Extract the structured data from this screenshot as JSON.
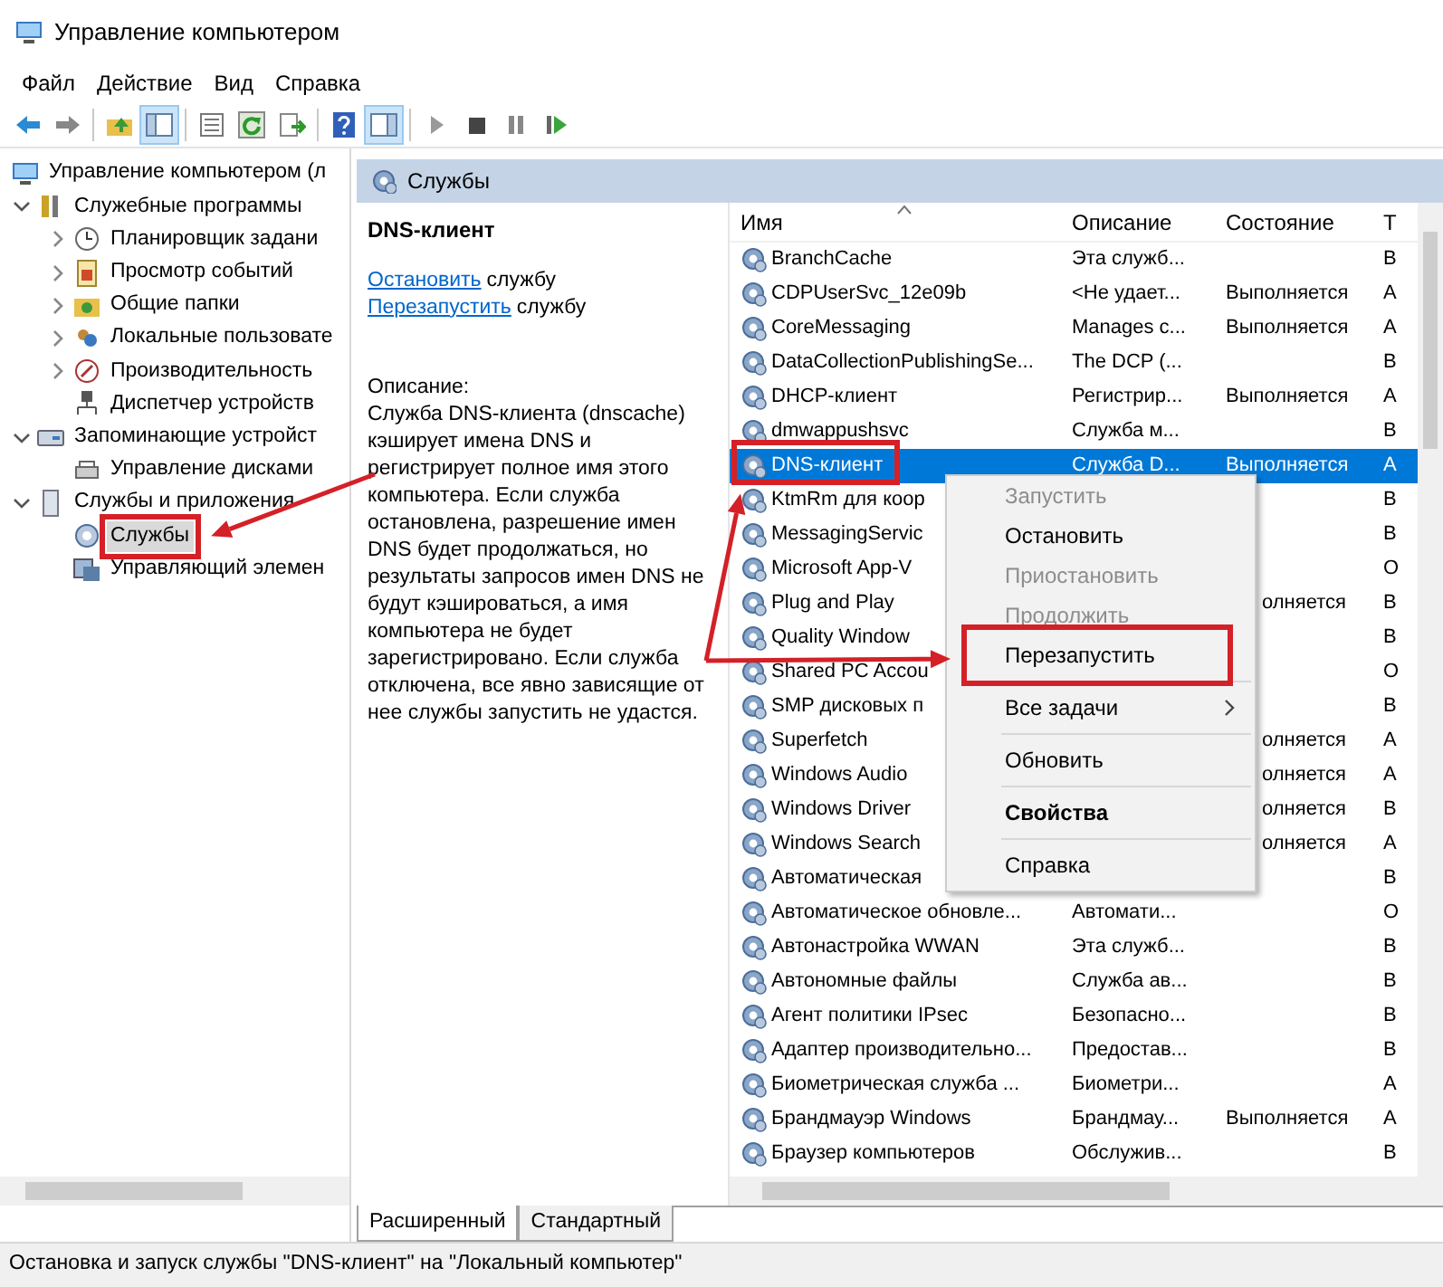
{
  "window": {
    "title": "Управление компьютером"
  },
  "menu": [
    "Файл",
    "Действие",
    "Вид",
    "Справка"
  ],
  "toolbar": [
    {
      "kind": "back",
      "pressed": false
    },
    {
      "kind": "forward",
      "pressed": false
    },
    {
      "kind": "sep"
    },
    {
      "kind": "up",
      "pressed": false
    },
    {
      "kind": "tree",
      "pressed": true
    },
    {
      "kind": "sep"
    },
    {
      "kind": "list",
      "pressed": false
    },
    {
      "kind": "refresh",
      "pressed": false
    },
    {
      "kind": "export",
      "pressed": false
    },
    {
      "kind": "sep"
    },
    {
      "kind": "help",
      "pressed": false
    },
    {
      "kind": "pane",
      "pressed": true
    },
    {
      "kind": "sep"
    },
    {
      "kind": "play",
      "pressed": false
    },
    {
      "kind": "stop",
      "pressed": false
    },
    {
      "kind": "pause",
      "pressed": false
    },
    {
      "kind": "restart",
      "pressed": false
    }
  ],
  "tree": {
    "label": "Управление компьютером (л",
    "selected": false,
    "children": [
      {
        "label": "Служебные программы",
        "expanded": true,
        "selected": false,
        "children": [
          {
            "label": "Планировщик задани",
            "expanded": false,
            "selected": false
          },
          {
            "label": "Просмотр событий",
            "expanded": false,
            "selected": false
          },
          {
            "label": "Общие папки",
            "expanded": false,
            "selected": false
          },
          {
            "label": "Локальные пользовате",
            "expanded": false,
            "selected": false
          },
          {
            "label": "Производительность",
            "expanded": false,
            "selected": false
          },
          {
            "label": "Диспетчер устройств",
            "selected": false
          }
        ]
      },
      {
        "label": "Запоминающие устройст",
        "expanded": true,
        "selected": false,
        "children": [
          {
            "label": "Управление дисками",
            "selected": false
          }
        ]
      },
      {
        "label": "Службы и приложения",
        "expanded": true,
        "selected": false,
        "children": [
          {
            "label": "Службы",
            "selected": true,
            "highlighted": true
          },
          {
            "label": "Управляющий элемен",
            "selected": false
          }
        ]
      }
    ]
  },
  "panel": {
    "title": "Службы"
  },
  "details": {
    "title": "DNS-клиент",
    "actions": [
      {
        "link": "Остановить",
        "text": "службу"
      },
      {
        "link": "Перезапустить",
        "text": "службу"
      }
    ],
    "description_label": "Описание:",
    "description": "Служба DNS-клиента (dnscache) кэширует имена DNS и регистрирует полное имя этого компьютера. Если служба остановлена, разрешение имен DNS будет продолжаться, но результаты запросов имен DNS не будут кэшироваться, а имя компьютера не будет зарегистрировано. Если служба отключена, все явно зависящие от нее службы запустить не удастся."
  },
  "list": {
    "columns": [
      "Имя",
      "Описание",
      "Состояние",
      "Т"
    ],
    "rows": [
      {
        "kind": "full",
        "name": "BranchCache",
        "description": "Эта служб...",
        "startup": "В",
        "selected": false
      },
      {
        "kind": "full",
        "name": "CDPUserSvc_12e09b",
        "description": "<Не удает...",
        "status": "Выполняется",
        "startup": "А",
        "selected": false
      },
      {
        "kind": "full",
        "name": "CoreMessaging",
        "description": "Manages c...",
        "status": "Выполняется",
        "startup": "А",
        "selected": false
      },
      {
        "kind": "full",
        "name": "DataCollectionPublishingSe...",
        "description": "The DCP (...",
        "startup": "В",
        "selected": false
      },
      {
        "kind": "full",
        "name": "DHCP-клиент",
        "description": "Регистрир...",
        "status": "Выполняется",
        "startup": "А",
        "selected": false
      },
      {
        "kind": "full",
        "name": "dmwappushsvc",
        "description": "Служба м...",
        "startup": "В",
        "selected": false
      },
      {
        "kind": "full",
        "name": "DNS-клиент",
        "description": "Служба D...",
        "status": "Выполняется",
        "startup": "А",
        "selected": true,
        "highlighted": true
      },
      {
        "kind": "covered",
        "name": "KtmRm для коор",
        "startup": "В",
        "selected": false
      },
      {
        "kind": "covered",
        "name": "MessagingServic",
        "startup": "В",
        "selected": false
      },
      {
        "kind": "covered",
        "name": "Microsoft App-V",
        "startup": "О",
        "selected": false
      },
      {
        "kind": "covered",
        "name": "Plug and Play",
        "status": "олняется",
        "startup": "В",
        "selected": false
      },
      {
        "kind": "covered",
        "name": "Quality Window",
        "startup": "В",
        "selected": false
      },
      {
        "kind": "covered",
        "name": "Shared PC Accou",
        "startup": "О",
        "selected": false
      },
      {
        "kind": "covered",
        "name": "SMP дисковых п",
        "startup": "В",
        "selected": false
      },
      {
        "kind": "covered",
        "name": "Superfetch",
        "status": "олняется",
        "startup": "А",
        "selected": false
      },
      {
        "kind": "covered",
        "name": "Windows Audio",
        "status": "олняется",
        "startup": "А",
        "selected": false
      },
      {
        "kind": "covered",
        "name": "Windows Driver",
        "status": "олняется",
        "startup": "В",
        "selected": false
      },
      {
        "kind": "covered",
        "name": "Windows Search",
        "status": "олняется",
        "startup": "А",
        "selected": false
      },
      {
        "kind": "covered",
        "name": "Автоматическая",
        "startup": "В",
        "selected": false
      },
      {
        "kind": "full",
        "name": "Автоматическое обновле...",
        "description": "Автомати...",
        "startup": "О",
        "selected": false
      },
      {
        "kind": "full",
        "name": "Автонастройка WWAN",
        "description": "Эта служб...",
        "startup": "В",
        "selected": false
      },
      {
        "kind": "full",
        "name": "Автономные файлы",
        "description": "Служба ав...",
        "startup": "В",
        "selected": false
      },
      {
        "kind": "full",
        "name": "Агент политики IPsec",
        "description": "Безопасно...",
        "startup": "В",
        "selected": false
      },
      {
        "kind": "full",
        "name": "Адаптер производительно...",
        "description": "Предостав...",
        "startup": "В",
        "selected": false
      },
      {
        "kind": "full",
        "name": "Биометрическая служба ...",
        "description": "Биометри...",
        "startup": "А",
        "selected": false
      },
      {
        "kind": "full",
        "name": "Брандмауэр Windows",
        "description": "Брандмау...",
        "status": "Выполняется",
        "startup": "А",
        "selected": false
      },
      {
        "kind": "full",
        "name": "Браузер компьютеров",
        "description": "Обслужив...",
        "startup": "В",
        "selected": false
      }
    ]
  },
  "context_menu": {
    "items": [
      {
        "kind": "item",
        "label": "Запустить",
        "disabled": true,
        "default": false
      },
      {
        "kind": "item",
        "label": "Остановить",
        "disabled": false,
        "default": false
      },
      {
        "kind": "item",
        "label": "Приостановить",
        "disabled": true,
        "default": false
      },
      {
        "kind": "item",
        "label": "Продолжить",
        "disabled": true,
        "default": false
      },
      {
        "kind": "item",
        "label": "Перезапустить",
        "disabled": false,
        "default": false,
        "highlighted": true
      },
      {
        "kind": "separator"
      },
      {
        "kind": "submenu",
        "label": "Все задачи",
        "disabled": false,
        "default": false
      },
      {
        "kind": "separator"
      },
      {
        "kind": "item",
        "label": "Обновить",
        "disabled": false,
        "default": false
      },
      {
        "kind": "separator"
      },
      {
        "kind": "item",
        "label": "Свойства",
        "disabled": false,
        "default": true
      },
      {
        "kind": "separator"
      },
      {
        "kind": "item",
        "label": "Справка",
        "disabled": false,
        "default": false
      }
    ]
  },
  "tabs": [
    {
      "label": "Расширенный",
      "selected": true
    },
    {
      "label": "Стандартный",
      "selected": false
    }
  ],
  "status_bar": "Остановка и запуск службы \"DNS-клиент\" на \"Локальный компьютер\""
}
